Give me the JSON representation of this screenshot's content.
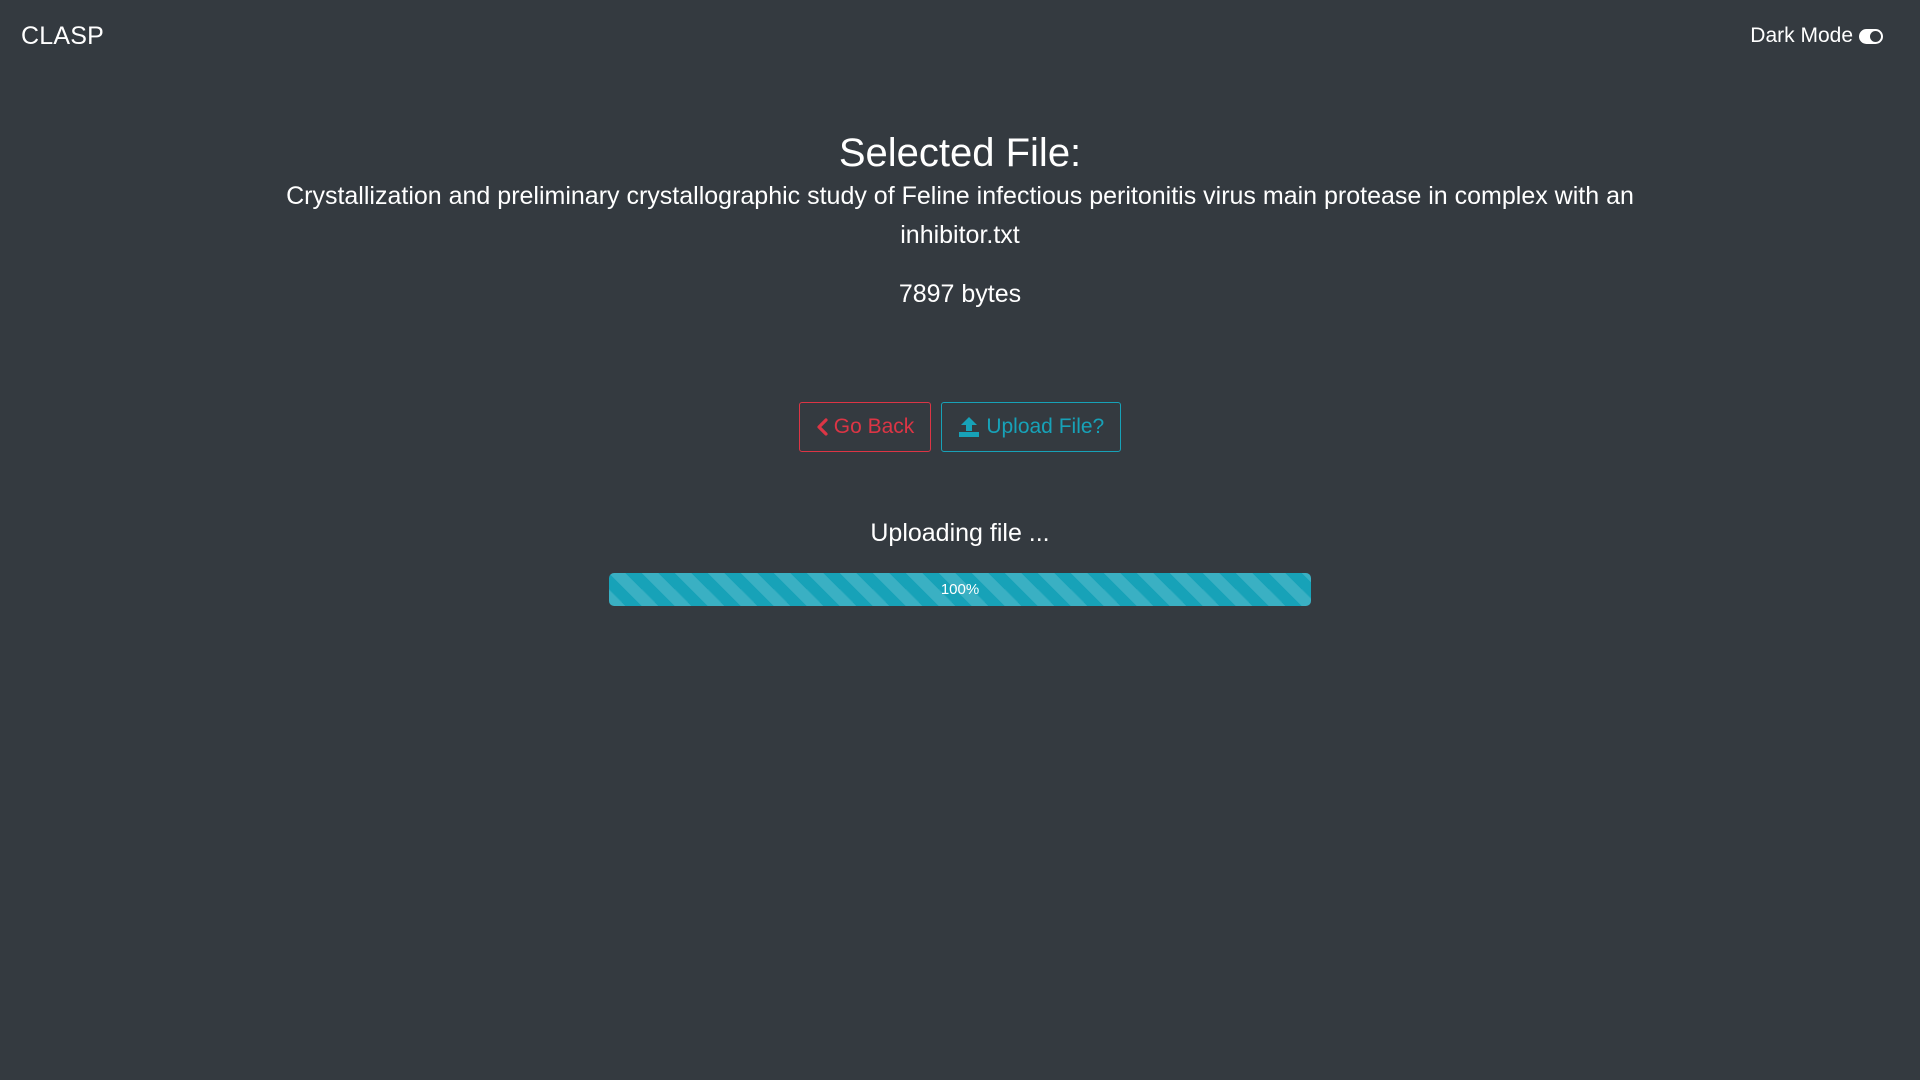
{
  "navbar": {
    "brand": "CLASP",
    "dark_mode_label": "Dark Mode",
    "dark_mode_icon": "toggle-on-icon",
    "dark_mode_enabled": true
  },
  "file": {
    "heading": "Selected File:",
    "name": "Crystallization and preliminary crystallographic study of Feline infectious peritonitis virus main protease in complex with an inhibitor.txt",
    "size": "7897 bytes"
  },
  "actions": {
    "back_label": "Go Back",
    "back_icon": "chevron-left-icon",
    "upload_label": "Upload File?",
    "upload_icon": "upload-icon"
  },
  "upload": {
    "status": "Uploading file ...",
    "progress_percent": 100,
    "progress_label": "100%"
  },
  "colors": {
    "background": "#343a40",
    "danger": "#dc3545",
    "info": "#17a2b8"
  }
}
